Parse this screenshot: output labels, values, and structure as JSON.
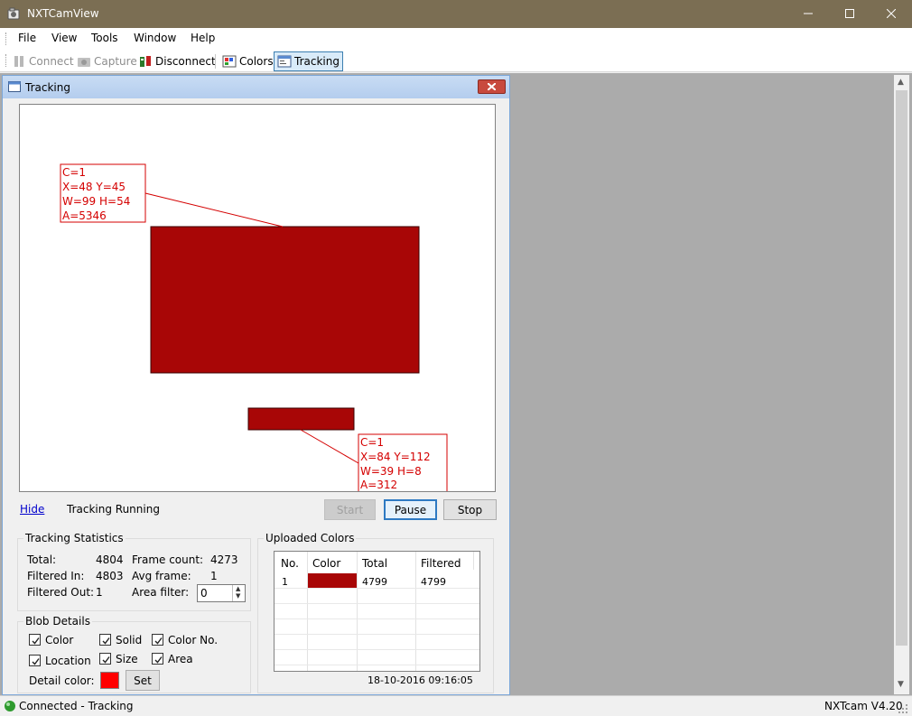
{
  "app": {
    "title": "NXTCamView",
    "icon": "camera-app-icon"
  },
  "menu": {
    "items": [
      "File",
      "View",
      "Tools",
      "Window",
      "Help"
    ]
  },
  "toolbar": {
    "connect_label": "Connect",
    "capture_label": "Capture",
    "disconnect_label": "Disconnect",
    "colors_label": "Colors",
    "tracking_label": "Tracking"
  },
  "tracking_window": {
    "title": "Tracking",
    "hide_label": "Hide",
    "status": "Tracking Running",
    "start_label": "Start",
    "pause_label": "Pause",
    "stop_label": "Stop",
    "blobs": [
      {
        "lines": [
          "C=1",
          "X=48 Y=45",
          "W=99 H=54",
          "A=5346"
        ],
        "color": "#a80606"
      },
      {
        "lines": [
          "C=1",
          "X=84 Y=112",
          "W=39 H=8",
          "A=312"
        ],
        "color": "#a80606"
      }
    ],
    "label_color": "#d40000"
  },
  "stats": {
    "title": "Tracking Statistics",
    "total_label": "Total:",
    "total_value": "4804",
    "filtered_in_label": "Filtered In:",
    "filtered_in_value": "4803",
    "filtered_out_label": "Filtered Out:",
    "filtered_out_value": "1",
    "frame_count_label": "Frame count:",
    "frame_count_value": "4273",
    "avg_frame_label": "Avg frame:",
    "avg_frame_value": "1",
    "area_filter_label": "Area filter:",
    "area_filter_value": "0"
  },
  "blob_details": {
    "title": "Blob Details",
    "color_label": "Color",
    "solid_label": "Solid",
    "color_no_label": "Color No.",
    "location_label": "Location",
    "size_label": "Size",
    "area_label": "Area",
    "detail_color_label": "Detail color:",
    "detail_color": "#ff0000",
    "set_label": "Set"
  },
  "uploaded_colors": {
    "title": "Uploaded Colors",
    "columns": [
      "No.",
      "Color",
      "Total",
      "Filtered"
    ],
    "rows": [
      {
        "no": "1",
        "color": "#a80606",
        "total": "4799",
        "filtered": "4799"
      }
    ],
    "timestamp": "18-10-2016 09:16:05"
  },
  "statusbar": {
    "left": "Connected - Tracking",
    "right": "NXTcam V4.20"
  }
}
